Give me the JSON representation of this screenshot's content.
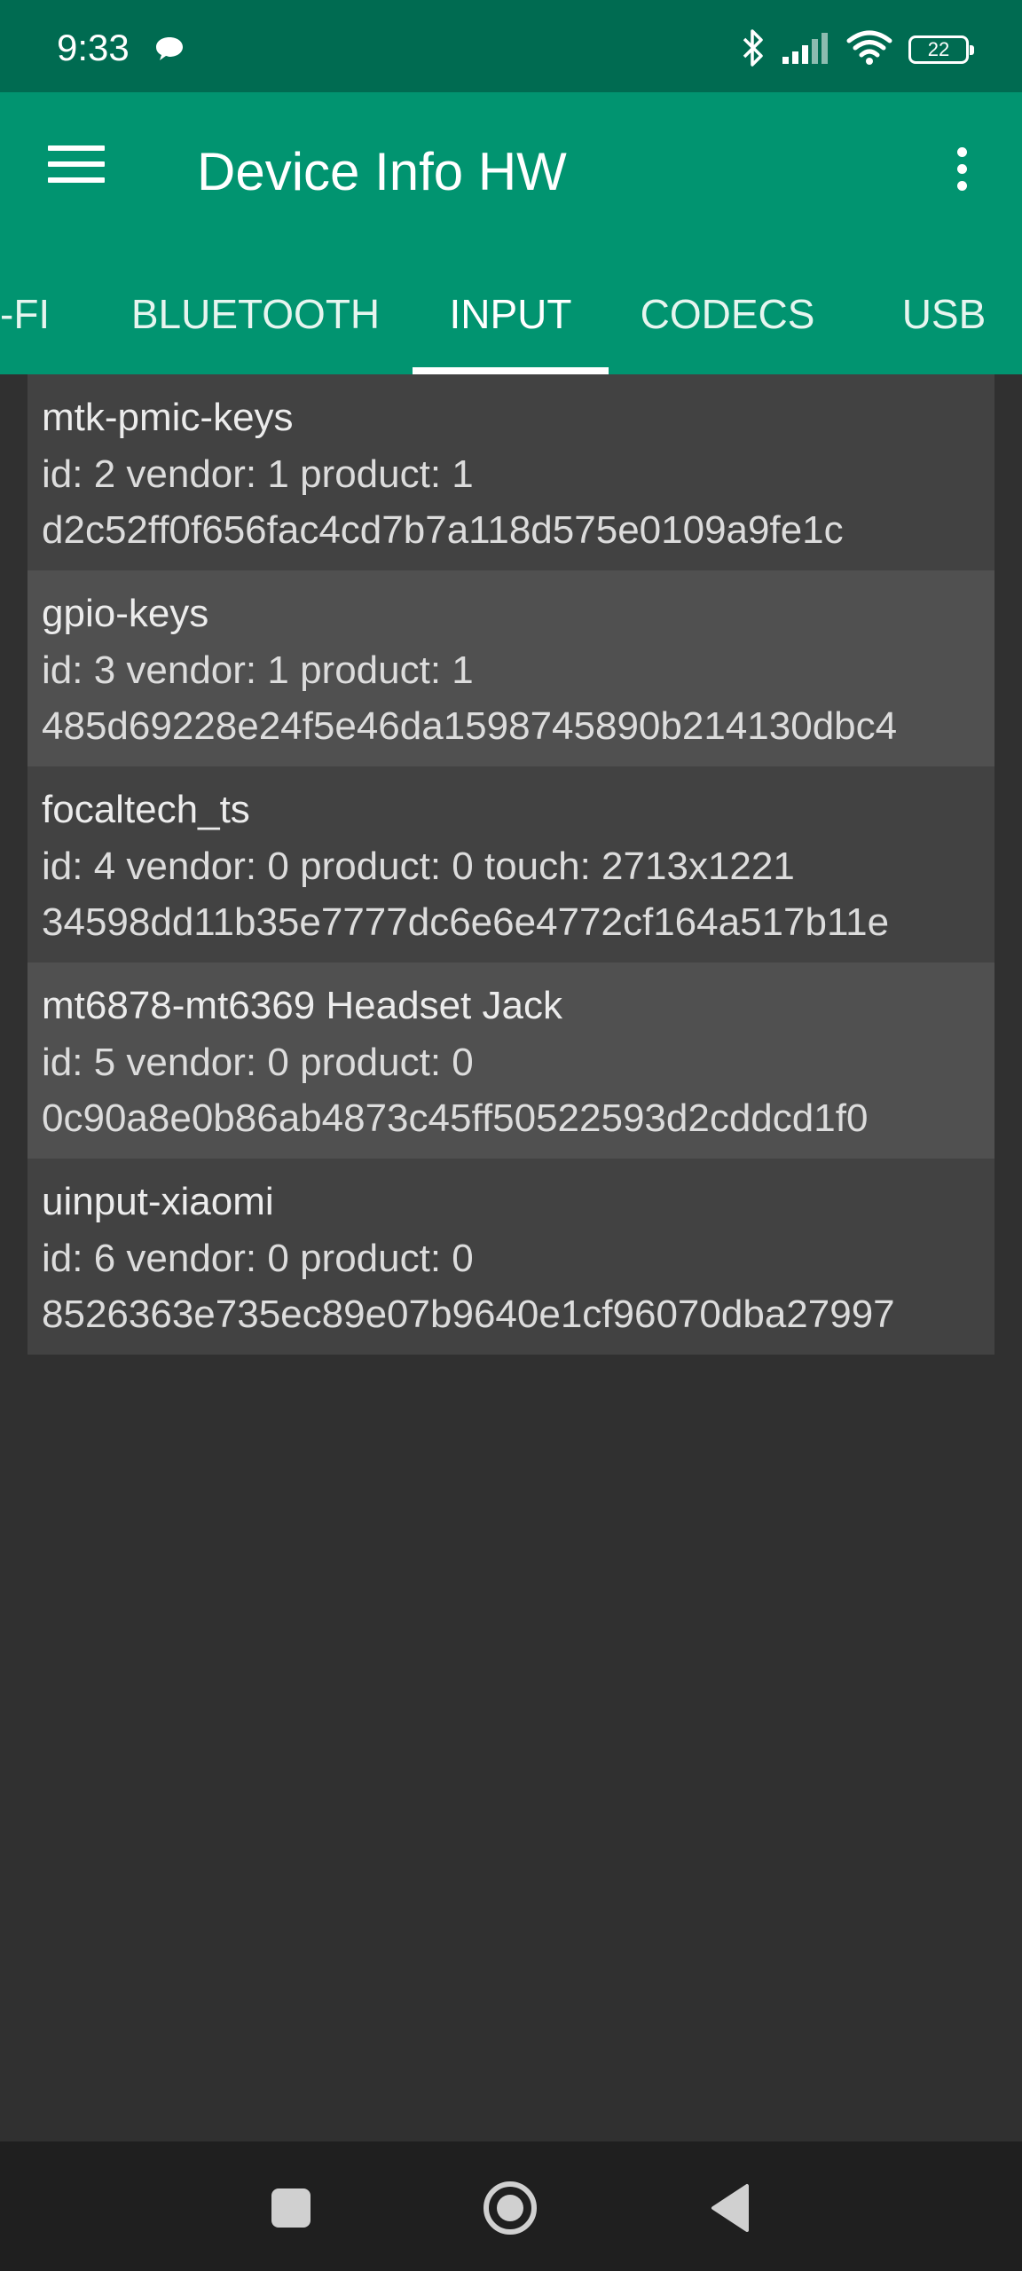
{
  "status_bar": {
    "time": "9:33",
    "battery": "22",
    "icons": [
      "chat-bubble-icon",
      "bluetooth-icon",
      "signal-icon",
      "wifi-icon",
      "battery-icon"
    ]
  },
  "app_bar": {
    "title": "Device Info HW",
    "menu_icon": "hamburger-menu-icon",
    "overflow_icon": "more-vert-icon"
  },
  "tabs": [
    {
      "label": "-FI",
      "selected": false
    },
    {
      "label": "BLUETOOTH",
      "selected": false
    },
    {
      "label": "INPUT",
      "selected": true
    },
    {
      "label": "CODECS",
      "selected": false
    },
    {
      "label": "USB",
      "selected": false
    }
  ],
  "devices": [
    {
      "name": "mtk-pmic-keys",
      "meta": "id: 2 vendor: 1 product: 1",
      "hash": "d2c52ff0f656fac4cd7b7a118d575e0109a9fe1c"
    },
    {
      "name": "gpio-keys",
      "meta": "id: 3 vendor: 1 product: 1",
      "hash": "485d69228e24f5e46da1598745890b214130dbc4"
    },
    {
      "name": "focaltech_ts",
      "meta": "id: 4 vendor: 0 product: 0 touch: 2713x1221",
      "hash": "34598dd11b35e7777dc6e6e4772cf164a517b11e"
    },
    {
      "name": "mt6878-mt6369 Headset Jack",
      "meta": "id: 5 vendor: 0 product: 0",
      "hash": "0c90a8e0b86ab4873c45ff50522593d2cddcd1f0"
    },
    {
      "name": "uinput-xiaomi",
      "meta": "id: 6 vendor: 0 product: 0",
      "hash": "8526363e735ec89e07b9640e1cf96070dba27997"
    }
  ],
  "nav_bar": {
    "icons": [
      "recents-square-icon",
      "home-circle-icon",
      "back-triangle-icon"
    ]
  },
  "colors": {
    "status_bar": "#006b51",
    "app_bar": "#019470",
    "background": "#303030",
    "row_dark": "#424242",
    "row_light": "#505050"
  }
}
